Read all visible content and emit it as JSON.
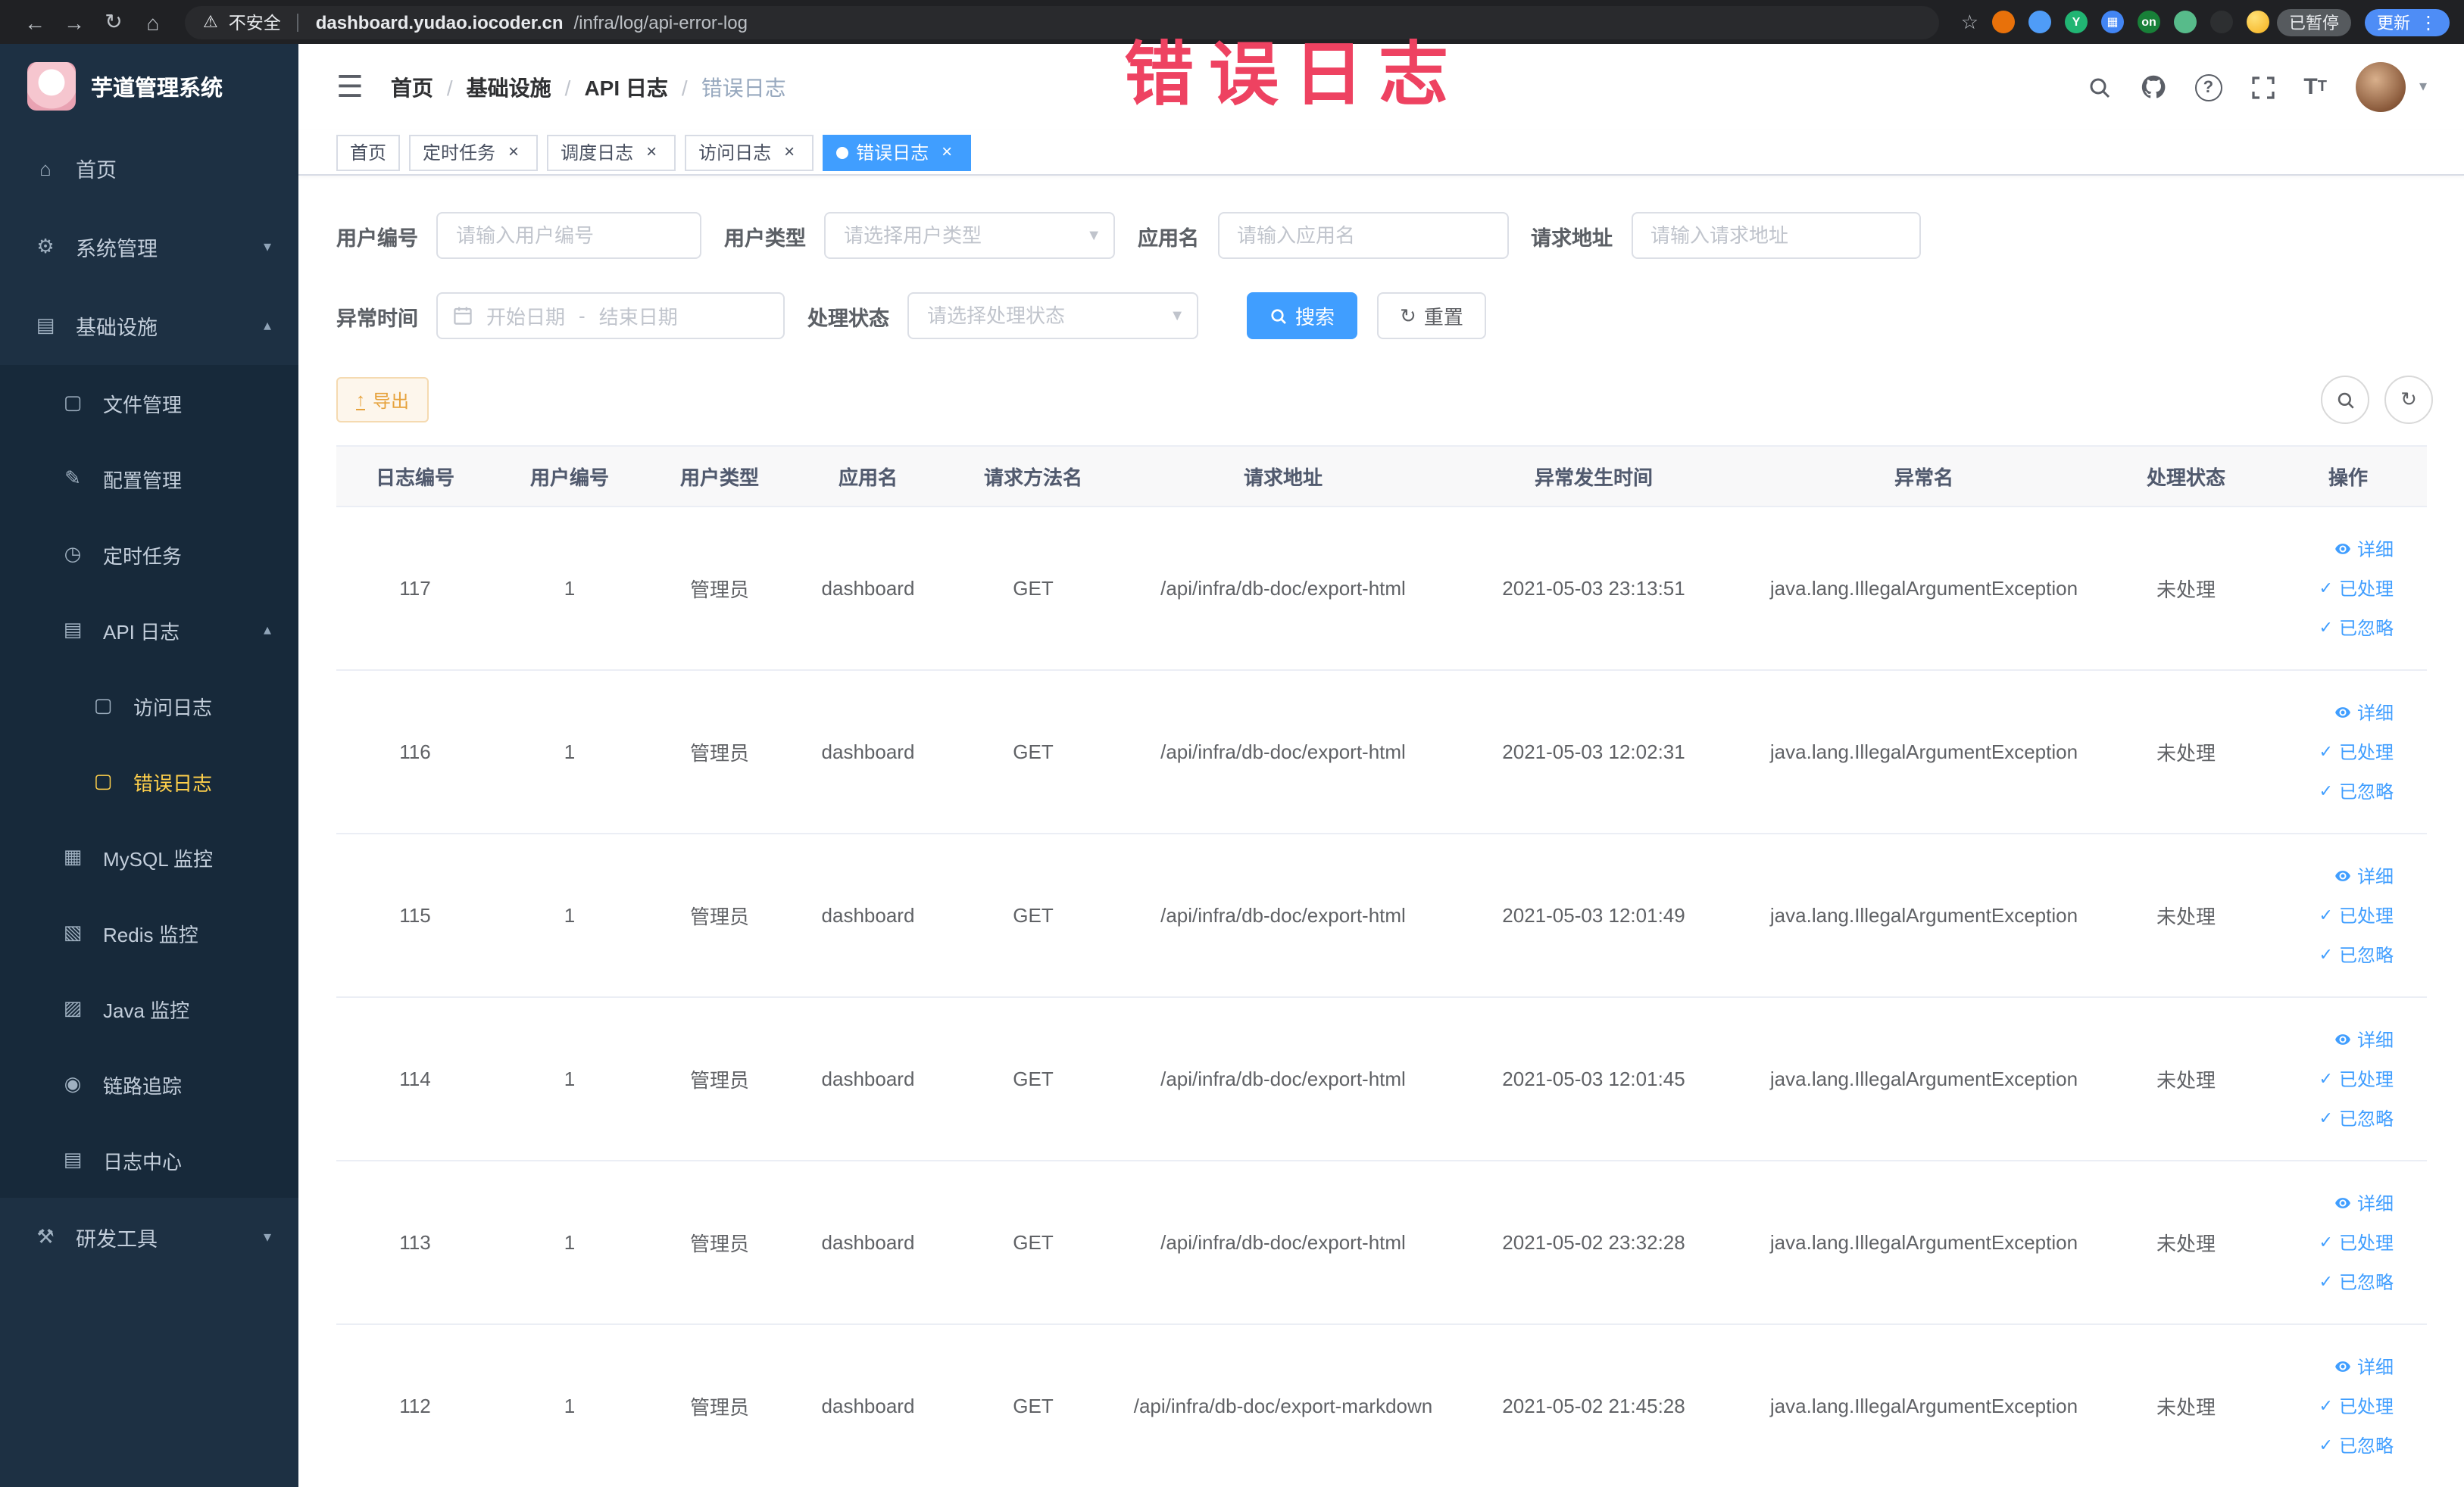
{
  "annotation": {
    "text": "错误日志"
  },
  "browser": {
    "security_label": "不安全",
    "url_domain": "dashboard.yudao.iocoder.cn",
    "url_path": "/infra/log/api-error-log",
    "paused_label": "已暂停",
    "update_label": "更新",
    "extensions": [
      {
        "name": "extension-orange-circle",
        "color": "#e8710a",
        "label": ""
      },
      {
        "name": "extension-blue-drop",
        "color": "#4f9cf7",
        "label": ""
      },
      {
        "name": "extension-teal-circle",
        "color": "#21b573",
        "label": "Y"
      },
      {
        "name": "extension-blue-grid",
        "color": "#4285f4",
        "label": "▦"
      },
      {
        "name": "extension-on-badge",
        "color": "#188038",
        "label": "on"
      },
      {
        "name": "extension-green-leaf",
        "color": "#57bb8a",
        "label": ""
      },
      {
        "name": "extension-dark-paw",
        "color": "#2d2f31",
        "label": ""
      }
    ]
  },
  "sidebar": {
    "logo_title": "芋道管理系统",
    "items": [
      {
        "label": "首页",
        "icon": "home-icon",
        "level": 0
      },
      {
        "label": "系统管理",
        "icon": "gear-icon",
        "level": 0,
        "chevron": "down"
      },
      {
        "label": "基础设施",
        "icon": "monitor-icon",
        "level": 0,
        "chevron": "up"
      },
      {
        "label": "文件管理",
        "icon": "folder-icon",
        "level": 1
      },
      {
        "label": "配置管理",
        "icon": "edit-icon",
        "level": 1
      },
      {
        "label": "定时任务",
        "icon": "timer-icon",
        "level": 1
      },
      {
        "label": "API 日志",
        "icon": "api-log-icon",
        "level": 1,
        "chevron": "up"
      },
      {
        "label": "访问日志",
        "icon": "doc-icon",
        "level": 2
      },
      {
        "label": "错误日志",
        "icon": "doc-icon",
        "level": 2,
        "active": true
      },
      {
        "label": "MySQL 监控",
        "icon": "mysql-icon",
        "level": 1
      },
      {
        "label": "Redis 监控",
        "icon": "redis-icon",
        "level": 1
      },
      {
        "label": "Java 监控",
        "icon": "java-icon",
        "level": 1
      },
      {
        "label": "链路追踪",
        "icon": "trace-icon",
        "level": 1
      },
      {
        "label": "日志中心",
        "icon": "log-center-icon",
        "level": 1
      },
      {
        "label": "研发工具",
        "icon": "tool-icon",
        "level": 0,
        "chevron": "down"
      }
    ]
  },
  "header": {
    "breadcrumb": [
      "首页",
      "基础设施",
      "API 日志",
      "错误日志"
    ]
  },
  "tabs": [
    {
      "name": "tab-home",
      "label": "首页",
      "closable": false,
      "active": false
    },
    {
      "name": "tab-scheduled-job",
      "label": "定时任务",
      "closable": true,
      "active": false
    },
    {
      "name": "tab-job-log",
      "label": "调度日志",
      "closable": true,
      "active": false
    },
    {
      "name": "tab-access-log",
      "label": "访问日志",
      "closable": true,
      "active": false
    },
    {
      "name": "tab-error-log",
      "label": "错误日志",
      "closable": true,
      "active": true
    }
  ],
  "filters": {
    "user_id_label": "用户编号",
    "user_id_placeholder": "请输入用户编号",
    "user_type_label": "用户类型",
    "user_type_placeholder": "请选择用户类型",
    "app_name_label": "应用名",
    "app_name_placeholder": "请输入应用名",
    "request_url_label": "请求地址",
    "request_url_placeholder": "请输入请求地址",
    "exception_time_label": "异常时间",
    "start_date_placeholder": "开始日期",
    "range_separator": "-",
    "end_date_placeholder": "结束日期",
    "process_status_label": "处理状态",
    "process_status_placeholder": "请选择处理状态",
    "search_label": "搜索",
    "reset_label": "重置"
  },
  "toolbar": {
    "export_label": "导出"
  },
  "table": {
    "headers": [
      "日志编号",
      "用户编号",
      "用户类型",
      "应用名",
      "请求方法名",
      "请求地址",
      "异常发生时间",
      "异常名",
      "处理状态",
      "操作"
    ],
    "actions": [
      {
        "name": "detail-link",
        "label": "详细",
        "icon": "eye-icon"
      },
      {
        "name": "mark-processed-link",
        "label": "已处理",
        "icon": "check-icon"
      },
      {
        "name": "mark-ignored-link",
        "label": "已忽略",
        "icon": "check-icon"
      }
    ],
    "rows": [
      {
        "id": "117",
        "user_id": "1",
        "user_type": "管理员",
        "app": "dashboard",
        "method": "GET",
        "url": "/api/infra/db-doc/export-html",
        "time": "2021-05-03 23:13:51",
        "exception": "java.lang.IllegalArgumentException",
        "status": "未处理"
      },
      {
        "id": "116",
        "user_id": "1",
        "user_type": "管理员",
        "app": "dashboard",
        "method": "GET",
        "url": "/api/infra/db-doc/export-html",
        "time": "2021-05-03 12:02:31",
        "exception": "java.lang.IllegalArgumentException",
        "status": "未处理"
      },
      {
        "id": "115",
        "user_id": "1",
        "user_type": "管理员",
        "app": "dashboard",
        "method": "GET",
        "url": "/api/infra/db-doc/export-html",
        "time": "2021-05-03 12:01:49",
        "exception": "java.lang.IllegalArgumentException",
        "status": "未处理"
      },
      {
        "id": "114",
        "user_id": "1",
        "user_type": "管理员",
        "app": "dashboard",
        "method": "GET",
        "url": "/api/infra/db-doc/export-html",
        "time": "2021-05-03 12:01:45",
        "exception": "java.lang.IllegalArgumentException",
        "status": "未处理"
      },
      {
        "id": "113",
        "user_id": "1",
        "user_type": "管理员",
        "app": "dashboard",
        "method": "GET",
        "url": "/api/infra/db-doc/export-html",
        "time": "2021-05-02 23:32:28",
        "exception": "java.lang.IllegalArgumentException",
        "status": "未处理"
      },
      {
        "id": "112",
        "user_id": "1",
        "user_type": "管理员",
        "app": "dashboard",
        "method": "GET",
        "url": "/api/infra/db-doc/export-markdown",
        "time": "2021-05-02 21:45:28",
        "exception": "java.lang.IllegalArgumentException",
        "status": "未处理"
      }
    ]
  }
}
